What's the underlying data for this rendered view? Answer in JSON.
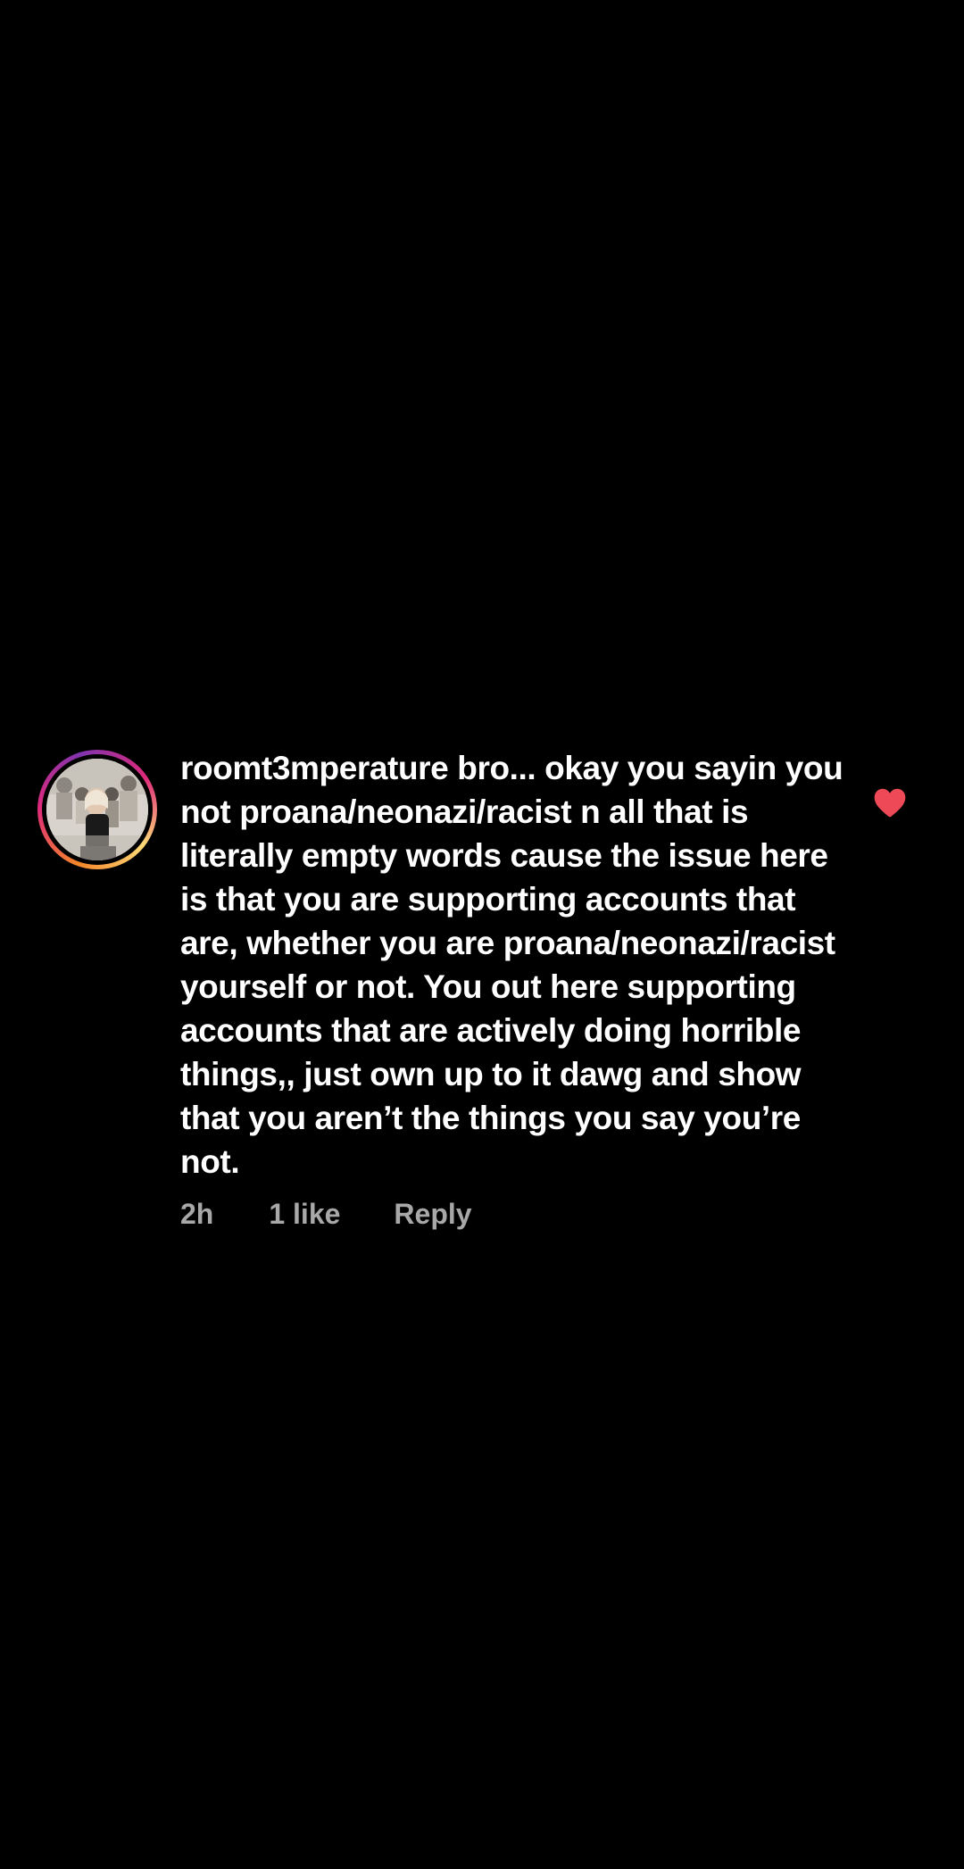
{
  "comment": {
    "username": "roomt3mperature",
    "text": "bro... okay you sayin you not proana/neonazi/racist n all that is literally empty words cause the issue here is that you are supporting accounts that are, whether you are proana/neonazi/racist yourself or not. You out here supporting accounts that are actively doing horrible things,, just own up to it dawg and show that you aren’t the things you say you’re not.",
    "time": "2h",
    "likes": "1 like",
    "reply_label": "Reply",
    "liked": true,
    "like_icon": "heart-icon"
  },
  "colors": {
    "background": "#000000",
    "text": "#ffffff",
    "meta": "#a8a8a8",
    "heart": "#ed4956"
  }
}
